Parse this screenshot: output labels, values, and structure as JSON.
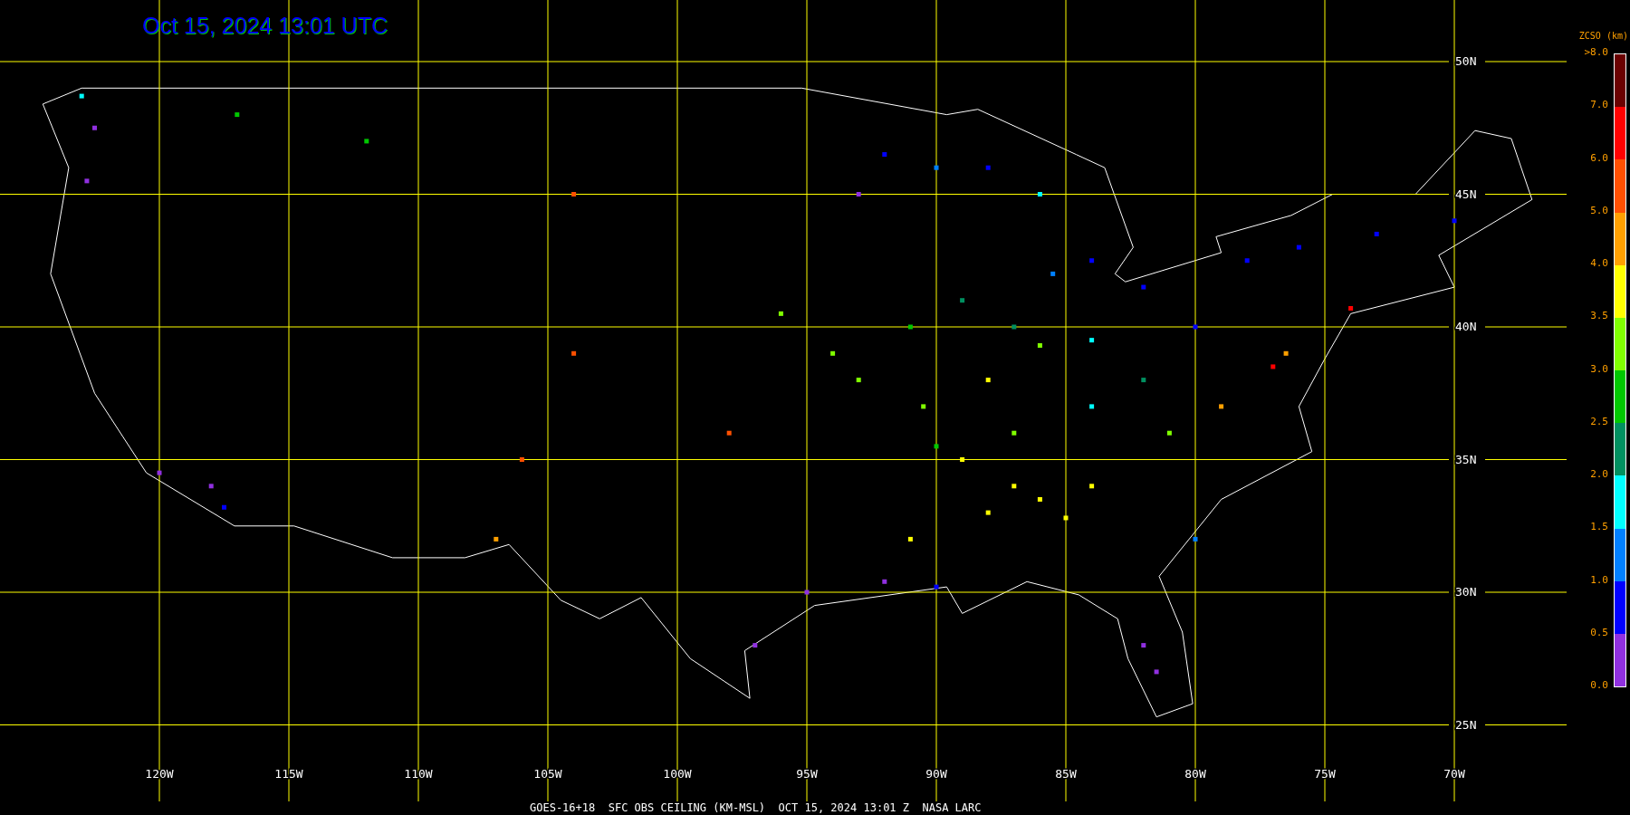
{
  "title": "Oct 15, 2024 13:01 UTC",
  "map": {
    "longitude_labels": [
      "120W",
      "115W",
      "110W",
      "105W",
      "100W",
      "95W",
      "90W",
      "85W",
      "80W",
      "75W",
      "70W"
    ],
    "latitude_labels": [
      "50N",
      "45N",
      "40N",
      "35N",
      "30N",
      "25N"
    ]
  },
  "legend": {
    "title": "ZCSO (km)",
    "ticks": [
      ">8.0",
      "7.0",
      "6.0",
      "5.0",
      "4.0",
      "3.5",
      "3.0",
      "2.5",
      "2.0",
      "1.5",
      "1.0",
      "0.5",
      "0.0"
    ],
    "segments": [
      {
        "color": "#6b0000"
      },
      {
        "color": "#ff0000"
      },
      {
        "color": "#ff5000"
      },
      {
        "color": "#ffa000"
      },
      {
        "color": "#ffff00"
      },
      {
        "color": "#80ff00"
      },
      {
        "color": "#00c800"
      },
      {
        "color": "#009060"
      },
      {
        "color": "#00ffff"
      },
      {
        "color": "#0080ff"
      },
      {
        "color": "#0000ff"
      },
      {
        "color": "#9030e0"
      }
    ]
  },
  "caption": "GOES-16+18  SFC OBS CEILING (KM-MSL)  OCT 15, 2024 13:01 Z  NASA LARC"
}
